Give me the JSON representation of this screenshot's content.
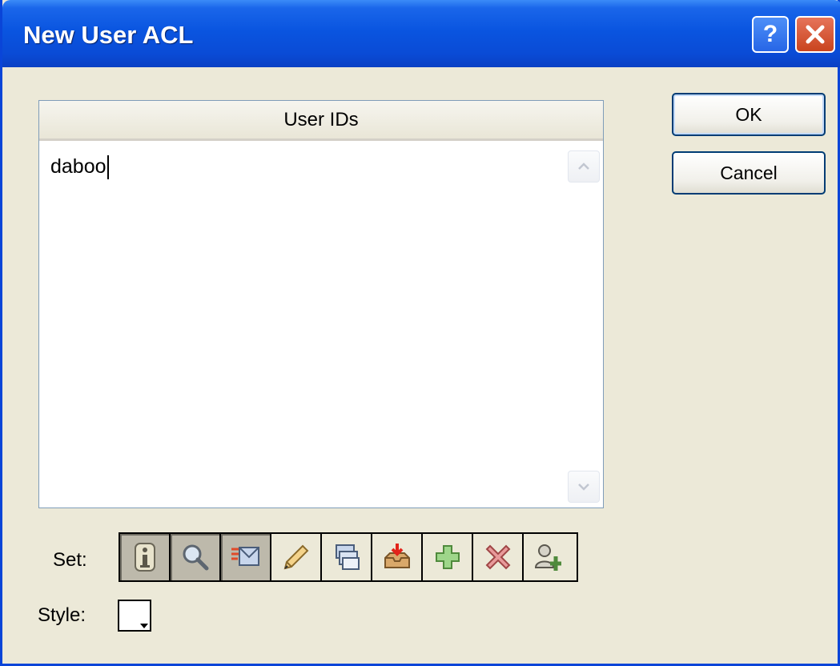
{
  "window": {
    "title": "New User ACL",
    "help_glyph": "?",
    "close_icon": "close-icon"
  },
  "list": {
    "header": "User IDs",
    "entries": [
      "daboo"
    ]
  },
  "buttons": {
    "ok": "OK",
    "cancel": "Cancel"
  },
  "set": {
    "label": "Set:",
    "tools": [
      {
        "icon": "info-icon",
        "pressed": true
      },
      {
        "icon": "magnifier-icon",
        "pressed": true
      },
      {
        "icon": "message-flag-icon",
        "pressed": true
      },
      {
        "icon": "pencil-icon",
        "pressed": false
      },
      {
        "icon": "stack-icon",
        "pressed": false
      },
      {
        "icon": "inbox-download-icon",
        "pressed": false
      },
      {
        "icon": "add-plus-icon",
        "pressed": false
      },
      {
        "icon": "delete-x-icon",
        "pressed": false
      },
      {
        "icon": "add-user-icon",
        "pressed": false
      }
    ]
  },
  "style": {
    "label": "Style:"
  },
  "colors": {
    "title_bar": "#0a55e0",
    "dialog_bg": "#ece9d8",
    "default_button_border": "#003c74"
  }
}
